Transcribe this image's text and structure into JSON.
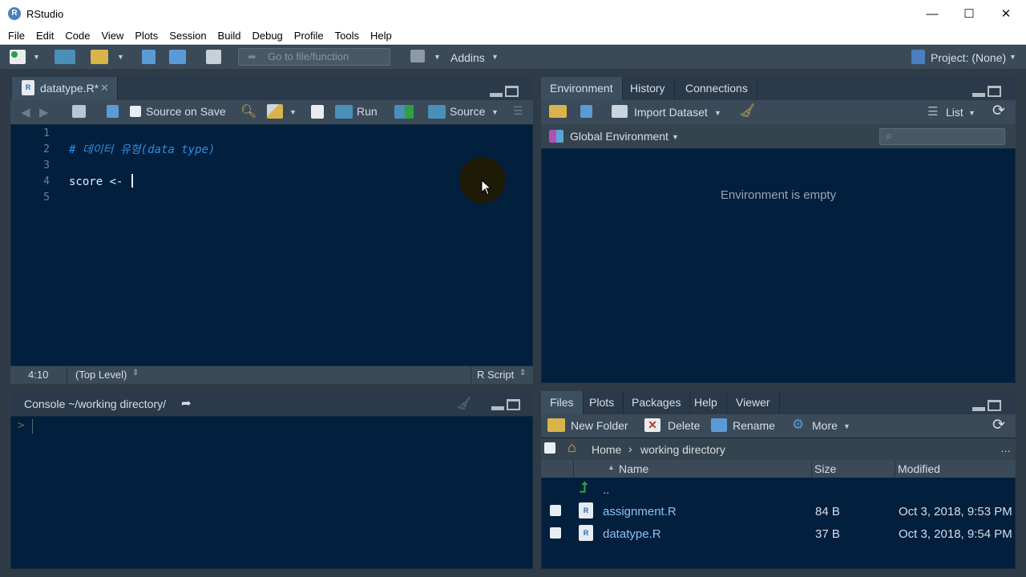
{
  "window": {
    "title": "RStudio",
    "minimize": "—",
    "maximize": "☐",
    "close": "✕"
  },
  "menu": [
    "File",
    "Edit",
    "Code",
    "View",
    "Plots",
    "Session",
    "Build",
    "Debug",
    "Profile",
    "Tools",
    "Help"
  ],
  "toolbar": {
    "goto_placeholder": "Go to file/function",
    "addins_label": "Addins",
    "project_label": "Project: (None)"
  },
  "editor": {
    "tab_label": "datatype.R*",
    "source_on_save": "Source on Save",
    "run_label": "Run",
    "source_label": "Source",
    "lines": [
      {
        "num": "1",
        "text": "",
        "kind": "code"
      },
      {
        "num": "2",
        "text": "# 데이터 유형(data type)",
        "kind": "comment"
      },
      {
        "num": "3",
        "text": "",
        "kind": "code"
      },
      {
        "num": "4",
        "text": "score <- ",
        "kind": "code"
      },
      {
        "num": "5",
        "text": "",
        "kind": "code"
      }
    ],
    "status": {
      "position": "4:10",
      "scope": "(Top Level)",
      "filetype": "R Script"
    }
  },
  "console": {
    "title": "Console ~/working directory/",
    "prompt": ">"
  },
  "env_pane": {
    "tabs": [
      "Environment",
      "History",
      "Connections"
    ],
    "import_label": "Import Dataset",
    "list_label": "List",
    "global_env": "Global Environment",
    "empty_message": "Environment is empty"
  },
  "files_pane": {
    "tabs": [
      "Files",
      "Plots",
      "Packages",
      "Help",
      "Viewer"
    ],
    "new_folder": "New Folder",
    "delete": "Delete",
    "rename": "Rename",
    "more": "More",
    "breadcrumb": {
      "home": "Home",
      "sep": "›",
      "dir": "working directory"
    },
    "columns": {
      "name": "Name",
      "size": "Size",
      "modified": "Modified"
    },
    "parent_label": "..",
    "rows": [
      {
        "name": "assignment.R",
        "size": "84 B",
        "modified": "Oct 3, 2018, 9:53 PM"
      },
      {
        "name": "datatype.R",
        "size": "37 B",
        "modified": "Oct 3, 2018, 9:54 PM"
      }
    ]
  },
  "colors": {
    "editor_bg": "#021f3e",
    "comment": "#2b8fe0",
    "link": "#8ec0ef",
    "toolbar": "#3a4a59"
  }
}
